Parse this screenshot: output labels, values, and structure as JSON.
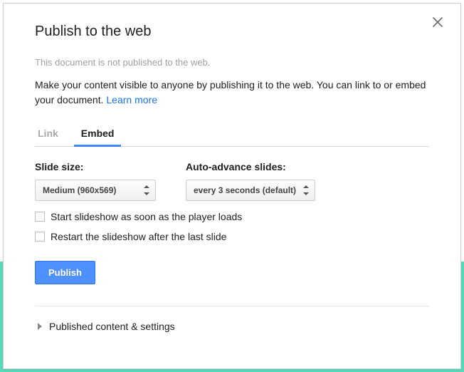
{
  "dialog": {
    "title": "Publish to the web",
    "subtitle": "This document is not published to the web.",
    "description_main": "Make your content visible to anyone by publishing it to the web. You can link to or embed your document. ",
    "learn_more": "Learn more",
    "tabs": {
      "link": "Link",
      "embed": "Embed"
    },
    "controls": {
      "size_label": "Slide size:",
      "size_value": "Medium (960x569)",
      "advance_label": "Auto-advance slides:",
      "advance_value": "every 3 seconds (default)"
    },
    "checkboxes": {
      "autostart": "Start slideshow as soon as the player loads",
      "restart": "Restart the slideshow after the last slide"
    },
    "publish_button": "Publish",
    "expander": "Published content & settings"
  }
}
